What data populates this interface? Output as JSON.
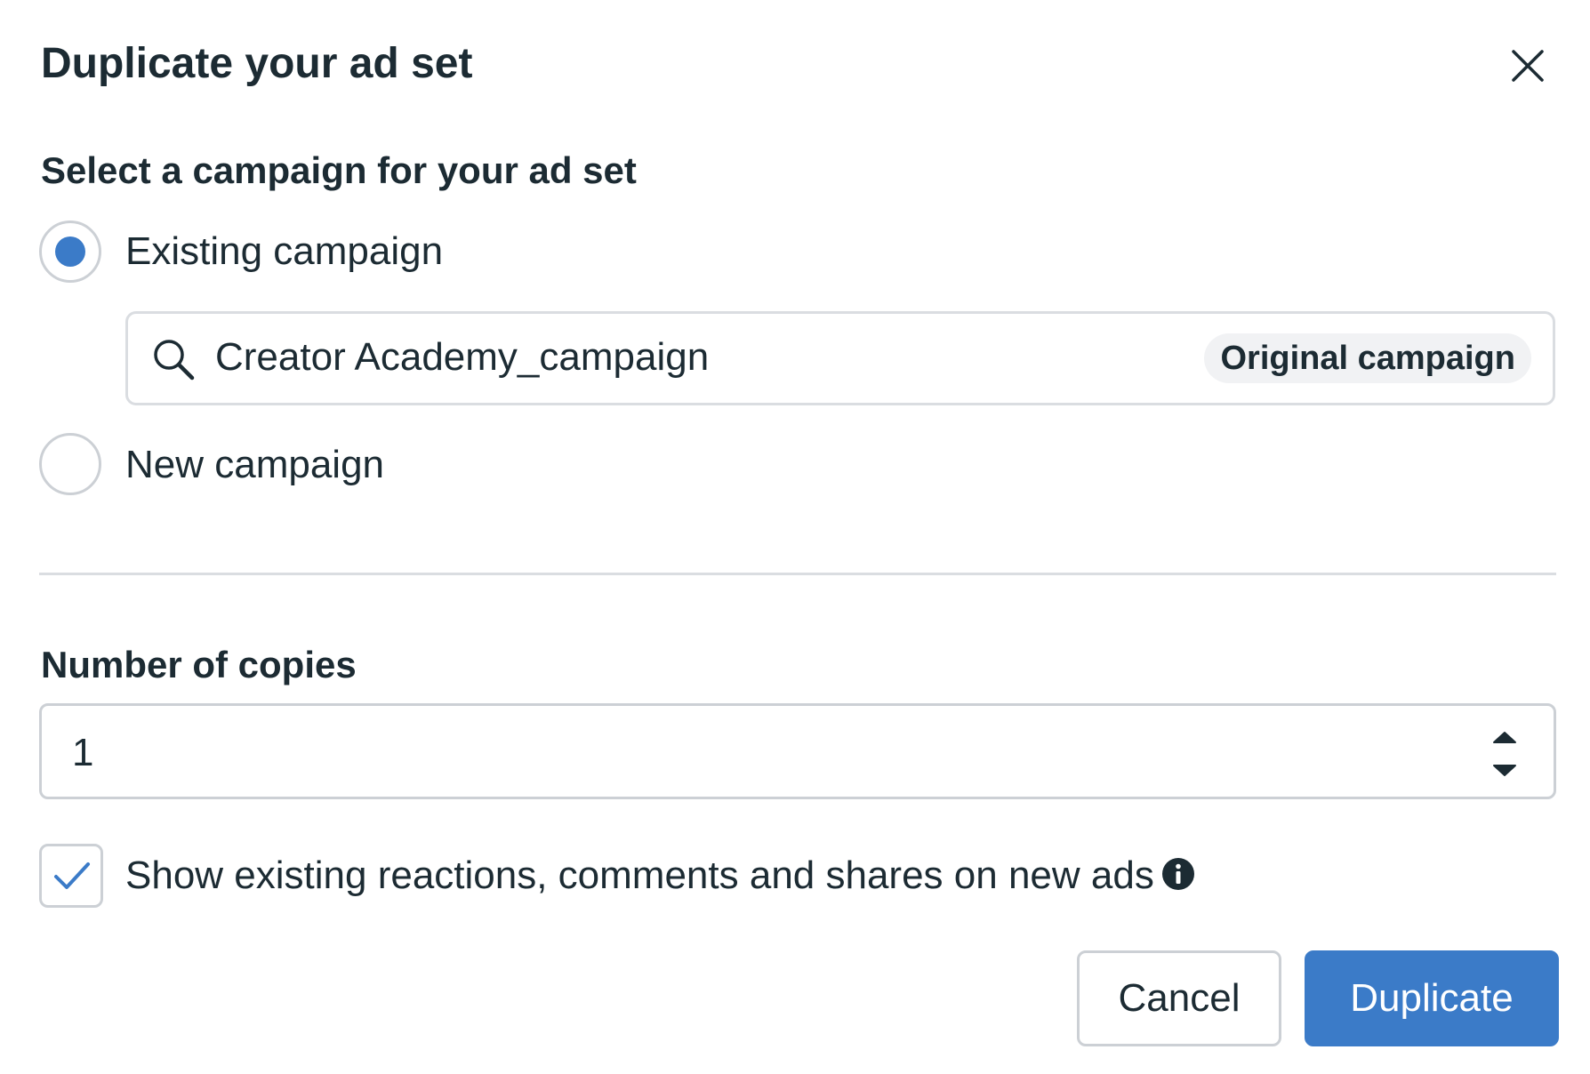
{
  "dialog": {
    "title": "Duplicate your ad set",
    "close_icon": "close-icon"
  },
  "campaign_section": {
    "label": "Select a campaign for your ad set",
    "options": [
      {
        "label": "Existing campaign",
        "selected": true
      },
      {
        "label": "New campaign",
        "selected": false
      }
    ],
    "search": {
      "icon": "search-icon",
      "value": "Creator Academy_campaign",
      "badge": "Original campaign"
    }
  },
  "copies_section": {
    "label": "Number of copies",
    "value": "1",
    "stepper_icon": "up-down-arrows-icon"
  },
  "show_engagement": {
    "checked": true,
    "label": "Show existing reactions, comments and shares on new ads",
    "info_icon": "info-icon"
  },
  "buttons": {
    "cancel": "Cancel",
    "duplicate": "Duplicate"
  },
  "colors": {
    "accent": "#3b7bc8",
    "text": "#1c2b33",
    "border": "#ccd0d5",
    "badge_bg": "#f1f2f4"
  }
}
